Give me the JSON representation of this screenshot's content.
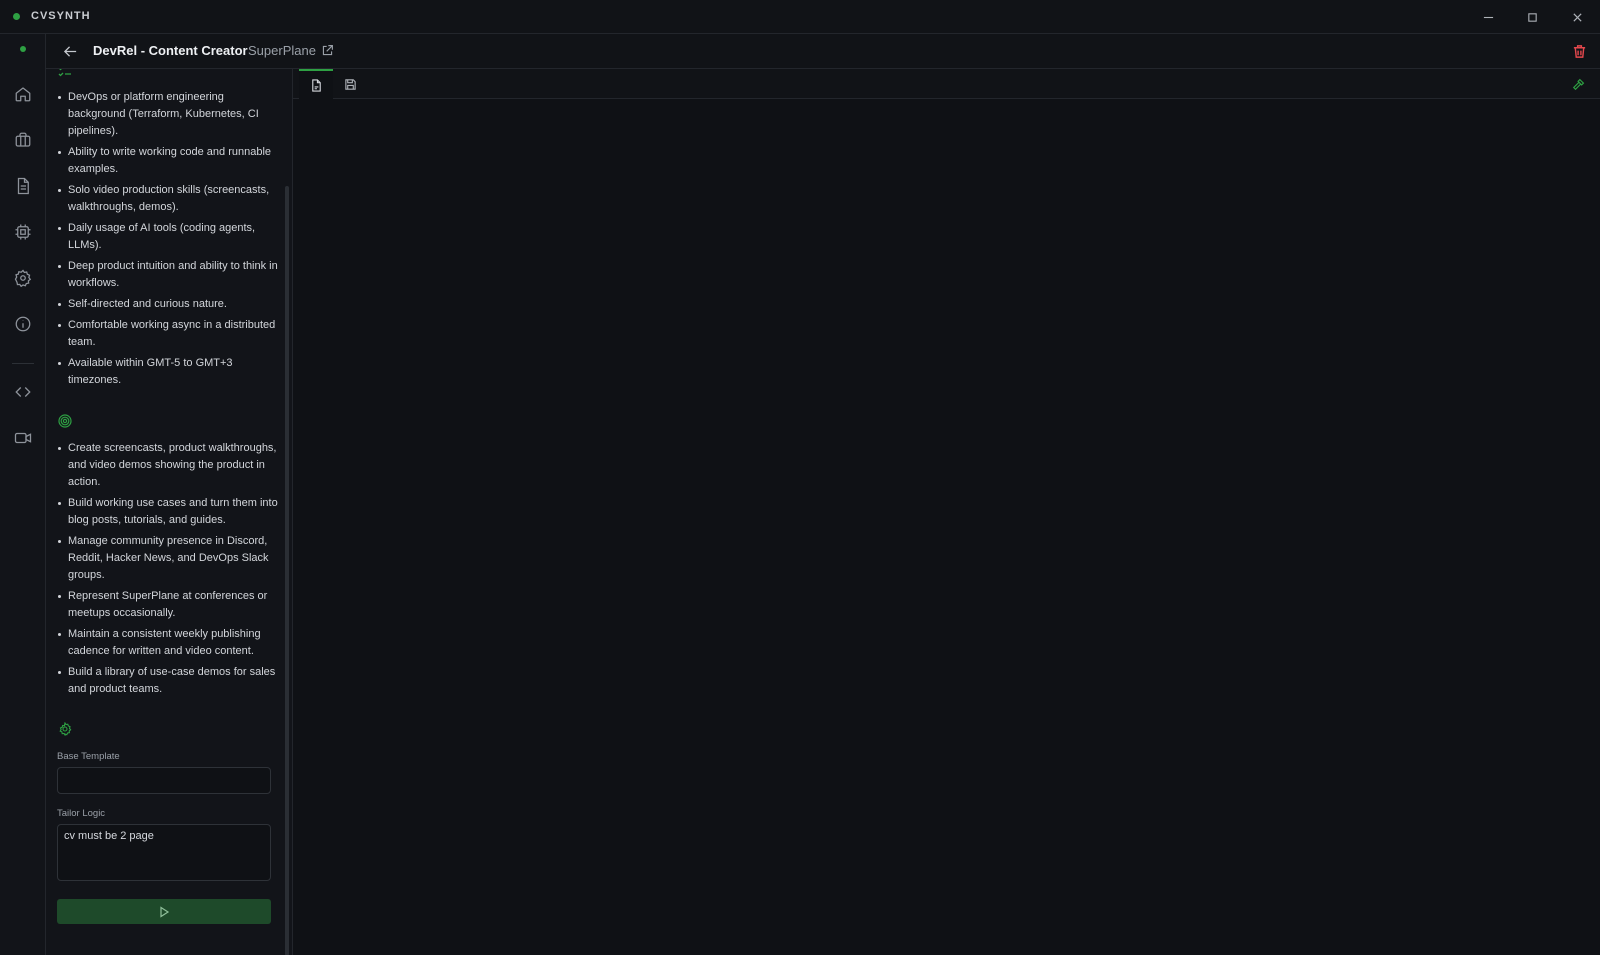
{
  "window": {
    "app_name": "CVSYNTH",
    "controls": [
      "minimize-icon",
      "maximize-icon",
      "close-icon"
    ]
  },
  "rail": {
    "items": [
      {
        "name": "home",
        "icon": "home-icon"
      },
      {
        "name": "jobs",
        "icon": "briefcase-icon"
      },
      {
        "name": "documents",
        "icon": "document-icon"
      },
      {
        "name": "models",
        "icon": "chip-icon"
      },
      {
        "name": "settings",
        "icon": "gear-icon"
      },
      {
        "name": "about",
        "icon": "info-icon"
      },
      {
        "name": "developer",
        "icon": "code-icon"
      },
      {
        "name": "video",
        "icon": "video-icon"
      }
    ]
  },
  "header": {
    "title": "DevRel - Content Creator",
    "company": "SuperPlane"
  },
  "panel": {
    "requirements": [
      "DevOps or platform engineering background (Terraform, Kubernetes, CI pipelines).",
      "Ability to write working code and runnable examples.",
      "Solo video production skills (screencasts, walkthroughs, demos).",
      "Daily usage of AI tools (coding agents, LLMs).",
      "Deep product intuition and ability to think in workflows.",
      "Self-directed and curious nature.",
      "Comfortable working async in a distributed team.",
      "Available within GMT-5 to GMT+3 timezones."
    ],
    "responsibilities": [
      "Create screencasts, product walkthroughs, and video demos showing the product in action.",
      "Build working use cases and turn them into blog posts, tutorials, and guides.",
      "Manage community presence in Discord, Reddit, Hacker News, and DevOps Slack groups.",
      "Represent SuperPlane at conferences or meetups occasionally.",
      "Maintain a consistent weekly publishing cadence for written and video content.",
      "Build a library of use-case demos for sales and product teams."
    ],
    "base_template_label": "Base Template",
    "base_template_value": "",
    "tailor_logic_label": "Tailor Logic",
    "tailor_logic_value": "cv must be 2 page"
  },
  "editor": {
    "tabs": [
      {
        "name": "document",
        "icon": "file-icon",
        "active": true
      },
      {
        "name": "save",
        "icon": "save-icon",
        "active": false
      }
    ]
  },
  "colors": {
    "accent": "#2ea043",
    "danger": "#e5484d",
    "background": "#0f1115"
  }
}
